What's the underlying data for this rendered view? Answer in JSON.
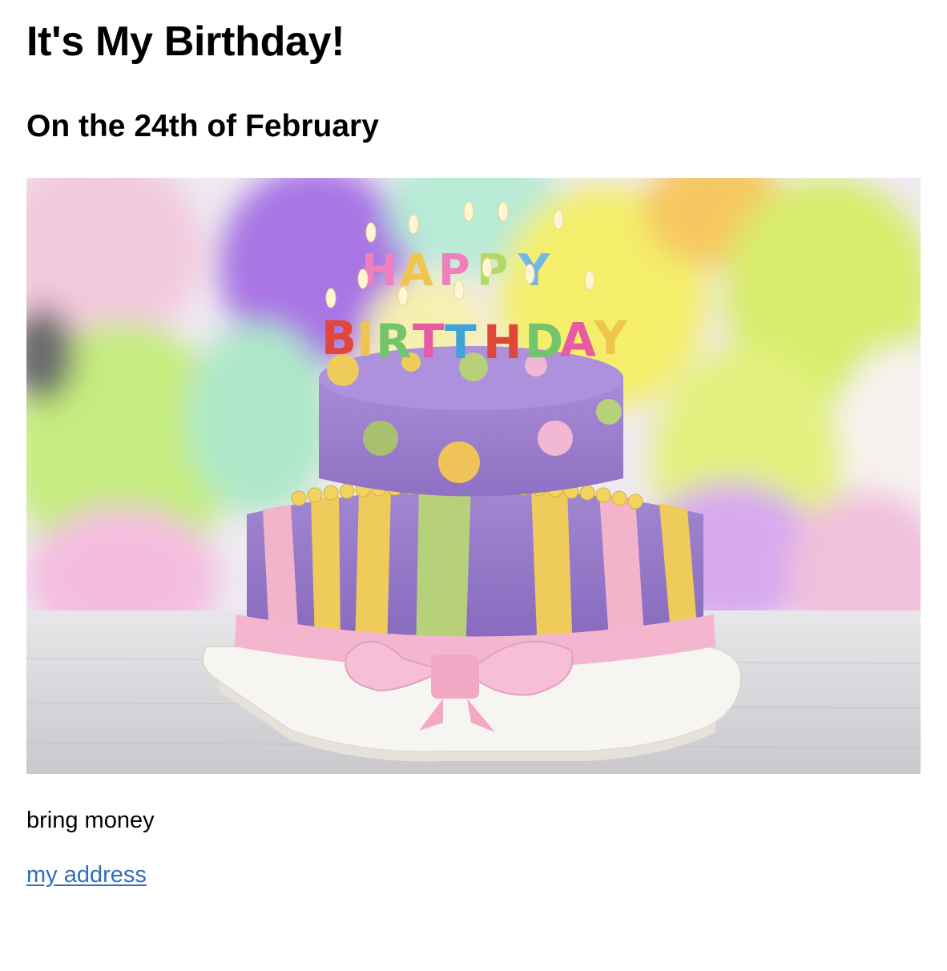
{
  "page": {
    "title": "It's My Birthday!",
    "subtitle": "On the 24th of February",
    "note": "bring money",
    "link_text": "my address"
  },
  "image": {
    "subject": "birthday-cake-photo",
    "candle_letters": "HAPPY BIRTHDAY",
    "colors": {
      "lavender": "#9d7fce",
      "pink": "#f1b6cf",
      "yellow": "#efcb5c",
      "green": "#b7d07a",
      "link_blue": "#2f6fba"
    }
  }
}
